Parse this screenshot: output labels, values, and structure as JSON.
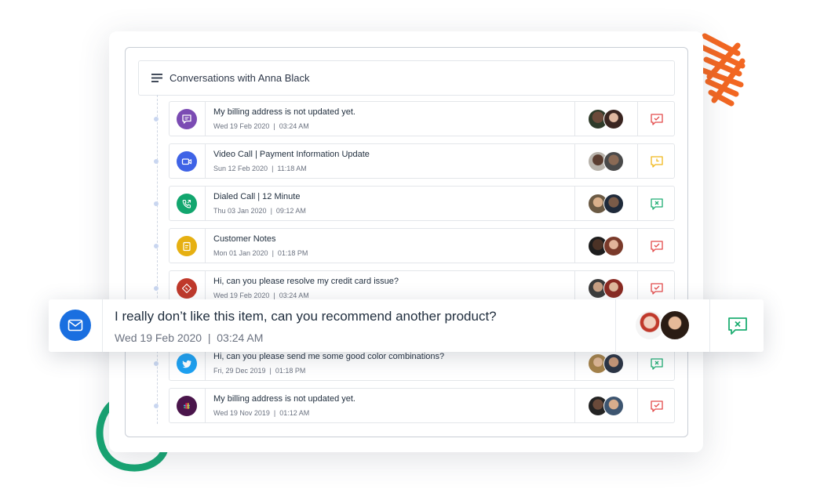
{
  "header": {
    "title": "Conversations with Anna Black",
    "icon": "menu-lines-icon"
  },
  "colors": {
    "chat": "#7b4bb3",
    "video": "#3f63e6",
    "call": "#12a66e",
    "notes": "#e6b012",
    "ticket": "#c0392b",
    "twitter": "#1da1f2",
    "slack": "#4a154b",
    "email": "#1a6fe0",
    "status_red": "#e34b4b",
    "status_yellow": "#f0b81c",
    "status_green": "#1fae73"
  },
  "rows": [
    {
      "title": "My billing address is not updated yet.",
      "date": "Wed 19 Feb 2020",
      "time": "03:24 AM",
      "icon": "chat-bubble-icon",
      "status": "resolved-red"
    },
    {
      "title": "Video Call  |  Payment Information Update",
      "date": "Sun 12 Feb 2020",
      "time": "11:18 AM",
      "icon": "video-camera-icon",
      "status": "pending-yellow"
    },
    {
      "title": "Dialed Call  |  12 Minute",
      "date": "Thu 03 Jan 2020",
      "time": "09:12 AM",
      "icon": "phone-outgoing-icon",
      "status": "closed-green"
    },
    {
      "title": "Customer Notes",
      "date": "Mon 01 Jan 2020",
      "time": "01:18 PM",
      "icon": "notepad-icon",
      "status": "resolved-red"
    },
    {
      "title": "Hi, can you please resolve my credit card issue?",
      "date": "Wed 19 Feb 2020",
      "time": "03:24 AM",
      "icon": "ticket-icon",
      "status": "resolved-red"
    },
    {
      "title": "Hi, can you please send me some good color combinations?",
      "date": "Fri, 29 Dec 2019",
      "time": "01:18 PM",
      "icon": "twitter-icon",
      "status": "closed-green"
    },
    {
      "title": "My billing address is not updated yet.",
      "date": "Wed 19 Nov 2019",
      "time": "01:12 AM",
      "icon": "slack-icon",
      "status": "resolved-red"
    }
  ],
  "highlight": {
    "title": "I really don’t like this item, can you recommend another product?",
    "date": "Wed 19 Feb 2020",
    "time": "03:24 AM",
    "icon": "envelope-icon",
    "status": "closed-green"
  }
}
